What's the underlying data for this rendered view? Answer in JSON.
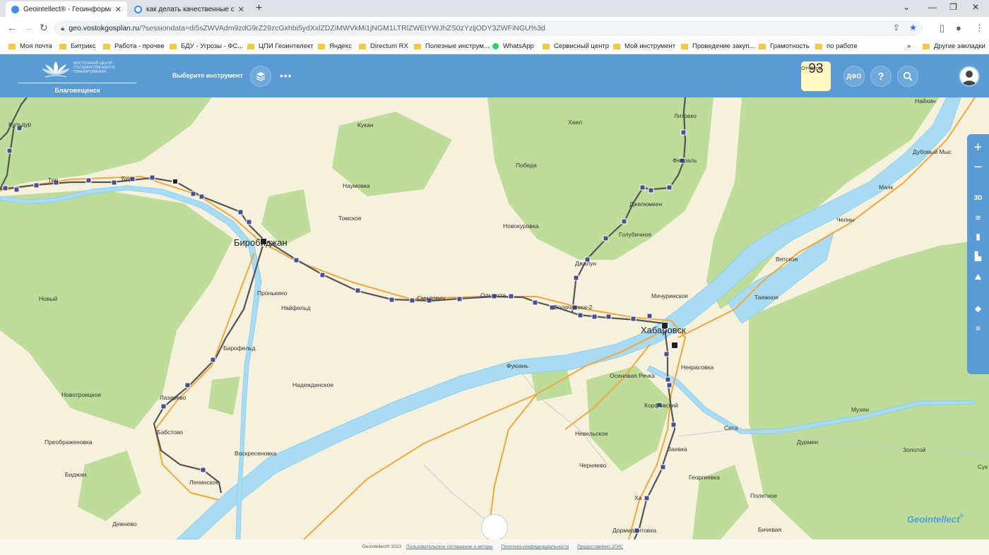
{
  "browser": {
    "tabs": [
      {
        "title": "Geointellect® - Геоинформацио",
        "active": true
      },
      {
        "title": "как делать качественные снимк",
        "active": false
      }
    ],
    "url_host": "geo.vostokgosplan.ru",
    "url_path": "/?sessiondata=di5sZWVAdm9zdG9rZ29zcGxhbi5ydXxlZDZiMWVkMi1jNGM1LTRlZWEtYWJhZS0zYzljODY3ZWFiNGU%3d",
    "bookmarks": [
      "Моя почта",
      "Битрикс",
      "Работа - прочее",
      "БДУ - Угрозы - ФС...",
      "ЦПИ Геоинтелект",
      "Яндекс",
      "Directum RX",
      "Полезные инструм...",
      "WhatsApp",
      "Сервисный центр",
      "Мой инструмент",
      "Проведение закуп...",
      "Грамотность",
      "по работе"
    ],
    "bookmarks_more": "»",
    "other_bookmarks": "Другие закладки"
  },
  "app": {
    "org_name": "ВОСТОЧНЫЙ ЦЕНТР ГОСУДАРСТВЕННОГО ПЛАНИРОВАНИЯ",
    "city": "Благовещенск",
    "tool_select": "Выберите инструмент",
    "more": "•••",
    "reports_label": "Отчётов",
    "reports_count": "93",
    "dfo": "ДФО",
    "help": "?"
  },
  "map": {
    "places": {
      "kuldur": "Кульдур",
      "ter": "Теп",
      "bir": "Бир",
      "kukan": "Кукан",
      "hail": "Хаил",
      "pobeda": "Победа",
      "naumovka": "Наумовка",
      "tomskoe": "Томское",
      "novokurovka": "Новокуровка",
      "birobidzhan": "Биробиджан",
      "pronkino": "Пронькино",
      "novy": "Новый",
      "naifeld": "Найфельд",
      "birofeld": "Бирофельд",
      "smidovich": "Смидович",
      "olgo": "Ольгохта",
      "volochaevka": "Волочаевка-2",
      "dzhelen": "Джелюмкен",
      "golubichnoe": "Голубичное",
      "dzhalun": "Джалун",
      "litovko": "Литовко",
      "mich": "Мичуринское",
      "khabarovsk": "Хабаровск",
      "nekrasovka": "Некрасовка",
      "fuyuan": "Фуюань",
      "osinovaya": "Осиновая Речка",
      "korfovsky": "Корфовский",
      "nadezhdinskoe": "Надеждинское",
      "novotroitskoe": "Новотроицкое",
      "lazarevo": "Лазарево",
      "babstovo": "Бабстово",
      "preobrazhenovka": "Преображеновка",
      "voskresenovka": "Воскресеновка",
      "nevelskoe": "Невельское",
      "chernyaevo": "Черняево",
      "zaevka": "Заевка",
      "georgievka": "Георгиевка",
      "bidzhan": "Биджан",
      "leninskoe": "Ленинское",
      "dezhnevo": "Дежнево",
      "poletnoe": "Полетное",
      "bicheva": "Бичевая",
      "dormidontovka": "Дормидонтовка",
      "naykhin": "Найхин",
      "dubovy": "Дубовый Мыс",
      "mayak": "Маяк",
      "chelny": "Челны",
      "vyatskoe": "Вятское",
      "taezhnoe": "Таежное",
      "muhen": "Мухен",
      "sita": "Сита",
      "durmin": "Дурмин",
      "zolotoy": "Золотой",
      "suk": "Сук",
      "ha": "Ха",
      "fevral": "Февраль"
    }
  },
  "map_controls": [
    "+",
    "−",
    "3D"
  ],
  "brand": "Geointellect",
  "footer": {
    "copyright": "Geointellect® 2023",
    "agreement": "Пользовательское соглашение и авторы",
    "privacy": "Политика конфиденциальности",
    "provider": "Предоставлено 2ГИС"
  }
}
